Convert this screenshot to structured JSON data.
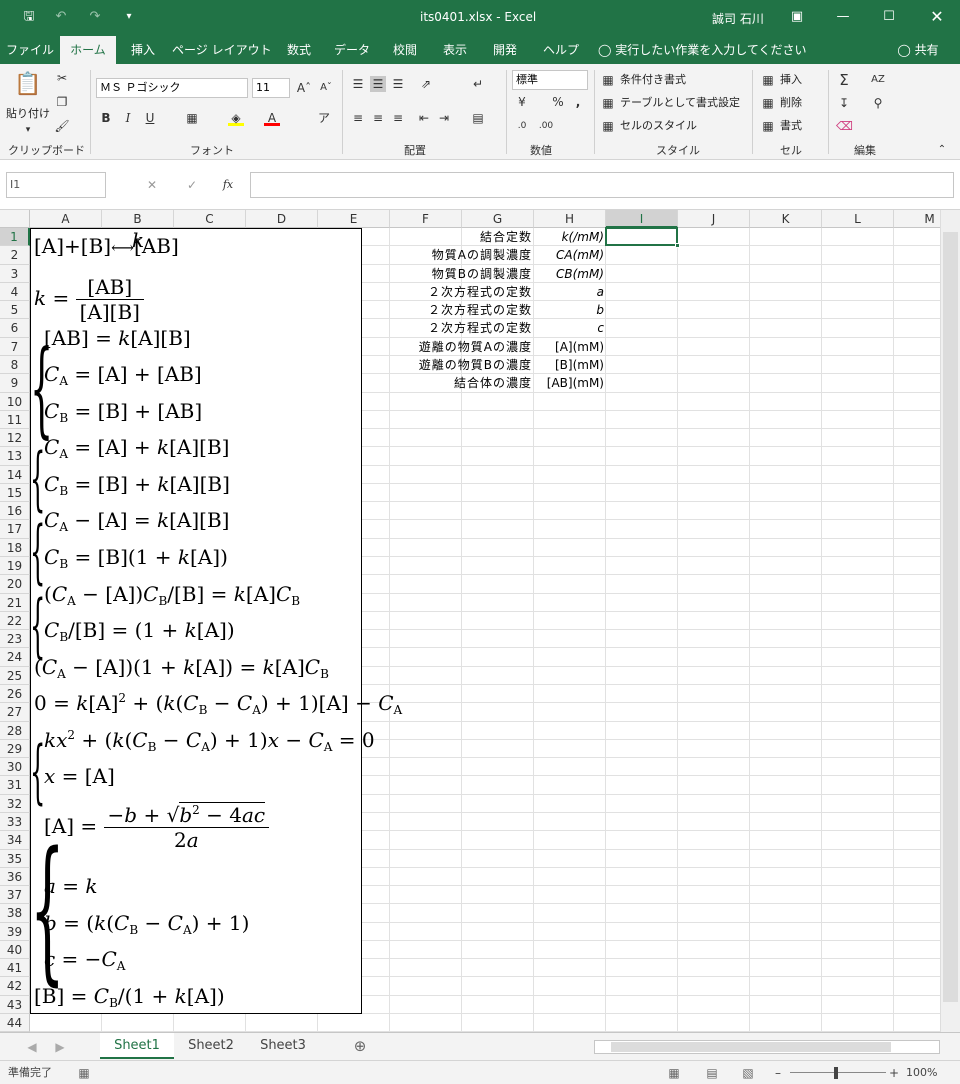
{
  "titlebar": {
    "title": "its0401.xlsx - Excel",
    "user": "誠司 石川"
  },
  "tabs": [
    "ファイル",
    "ホーム",
    "挿入",
    "ページ レイアウト",
    "数式",
    "データ",
    "校閲",
    "表示",
    "開発",
    "ヘルプ"
  ],
  "tell_me": "実行したい作業を入力してください",
  "share": "共有",
  "ribbon": {
    "paste_label": "貼り付け",
    "font_name": "ＭＳ Ｐゴシック",
    "font_size": "11",
    "number_format": "標準",
    "conditional_format": "条件付き書式",
    "format_as_table": "テーブルとして書式設定",
    "cell_styles": "セルのスタイル",
    "insert": "挿入",
    "delete": "削除",
    "format": "書式",
    "groups": {
      "clipboard": "クリップボード",
      "font": "フォント",
      "alignment": "配置",
      "number": "数値",
      "styles": "スタイル",
      "cells": "セル",
      "editing": "編集"
    }
  },
  "formula_bar": {
    "name_box": "I1",
    "fx": "fx",
    "formula": ""
  },
  "columns": [
    "A",
    "B",
    "C",
    "D",
    "E",
    "F",
    "G",
    "H",
    "I",
    "J",
    "K",
    "L",
    "M"
  ],
  "rows": [
    "1",
    "2",
    "3",
    "4",
    "5",
    "6",
    "7",
    "8",
    "9",
    "10",
    "11",
    "12",
    "13",
    "14",
    "15",
    "16",
    "17",
    "18",
    "19",
    "20",
    "21",
    "22",
    "23",
    "24",
    "25",
    "26",
    "27",
    "28",
    "29",
    "30",
    "31",
    "32",
    "33",
    "34",
    "35",
    "36",
    "37",
    "38",
    "39",
    "40",
    "41",
    "42",
    "43",
    "44"
  ],
  "table": [
    {
      "label": "結合定数",
      "unit": "k(/mM)"
    },
    {
      "label": "物質Aの調製濃度",
      "unit": "CA(mM)"
    },
    {
      "label": "物質Bの調製濃度",
      "unit": "CB(mM)"
    },
    {
      "label": "２次方程式の定数",
      "unit": "a"
    },
    {
      "label": "２次方程式の定数",
      "unit": "b"
    },
    {
      "label": "２次方程式の定数",
      "unit": "c"
    },
    {
      "label": "遊離の物質Aの濃度",
      "unit": "[A](mM)"
    },
    {
      "label": "遊離の物質Bの濃度",
      "unit": "[B](mM)"
    },
    {
      "label": "結合体の濃度",
      "unit": "[AB](mM)"
    }
  ],
  "sheets": [
    "Sheet1",
    "Sheet2",
    "Sheet3"
  ],
  "status": {
    "ready": "準備完了",
    "zoom": "100%"
  }
}
